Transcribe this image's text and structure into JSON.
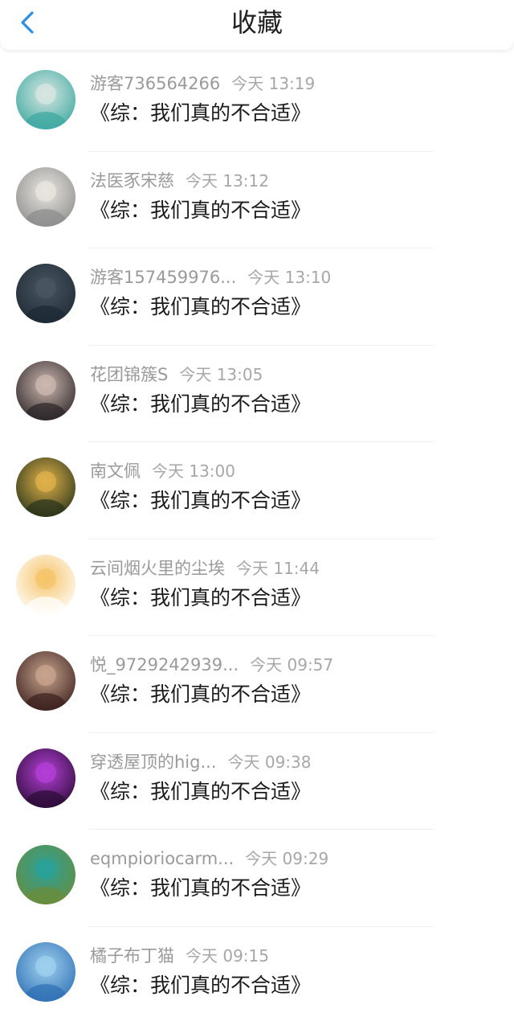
{
  "header": {
    "title": "收藏",
    "back_icon": "chevron-left-icon",
    "accent": "#2d8fe4"
  },
  "items": [
    {
      "user": "游客736564266",
      "time": "今天 13:19",
      "book": "《综：我们真的不合适》",
      "avatar_colors": [
        "#3aa8a0",
        "#d8e6e2"
      ]
    },
    {
      "user": "法医豕宋慈",
      "time": "今天 13:12",
      "book": "《综：我们真的不合适》",
      "avatar_colors": [
        "#8c8c8c",
        "#e9e6df"
      ]
    },
    {
      "user": "游客157459976...",
      "time": "今天 13:10",
      "book": "《综：我们真的不合适》",
      "avatar_colors": [
        "#1d2a34",
        "#4a5560"
      ]
    },
    {
      "user": "花团锦簇S",
      "time": "今天 13:05",
      "book": "《综：我们真的不合适》",
      "avatar_colors": [
        "#2a2426",
        "#cdb8b0"
      ]
    },
    {
      "user": "南文佩",
      "time": "今天 13:00",
      "book": "《综：我们真的不合适》",
      "avatar_colors": [
        "#26321a",
        "#e0b24a"
      ]
    },
    {
      "user": "云间烟火里的尘埃",
      "time": "今天 11:44",
      "book": "《综：我们真的不合适》",
      "avatar_colors": [
        "#ffffff",
        "#f6c46a"
      ]
    },
    {
      "user": "悦_9729242939...",
      "time": "今天 09:57",
      "book": "《综：我们真的不合适》",
      "avatar_colors": [
        "#3a1f1d",
        "#c8a48e"
      ]
    },
    {
      "user": "穿透屋顶的hig...",
      "time": "今天 09:38",
      "book": "《综：我们真的不合适》",
      "avatar_colors": [
        "#2a0c33",
        "#b43fd8"
      ]
    },
    {
      "user": "eqmpioriocarm...",
      "time": "今天 09:29",
      "book": "《综：我们真的不合适》",
      "avatar_colors": [
        "#6b8c3a",
        "#2aa29a"
      ]
    },
    {
      "user": "橘子布丁猫",
      "time": "今天 09:15",
      "book": "《综：我们真的不合适》",
      "avatar_colors": [
        "#2d6fb4",
        "#9fd0ee"
      ]
    }
  ]
}
